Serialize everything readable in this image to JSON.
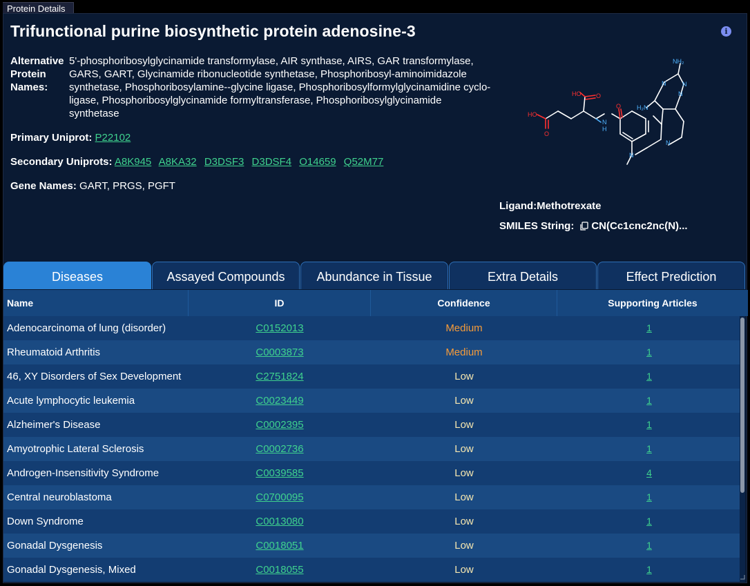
{
  "window": {
    "tab_title": "Protein Details"
  },
  "protein": {
    "title": "Trifunctional purine biosynthetic protein adenosine-3",
    "alt_names_label": "Alternative Protein Names:",
    "alt_names_value": "5'-phosphoribosylglycinamide transformylase, AIR synthase, AIRS, GAR transformylase, GARS, GART, Glycinamide ribonucleotide synthetase, Phosphoribosyl-aminoimidazole synthetase, Phosphoribosylamine--glycine ligase, Phosphoribosylformylglycinamidine cyclo-ligase, Phosphoribosylglycinamide formyltransferase, Phosphoribosylglycinamide synthetase",
    "primary_uniprot_label": "Primary Uniprot:",
    "primary_uniprot": "P22102",
    "secondary_uniprots_label": "Secondary Uniprots:",
    "secondary_uniprots": [
      "A8K945",
      "A8KA32",
      "D3DSF3",
      "D3DSF4",
      "O14659",
      "Q52M77"
    ],
    "gene_names_label": "Gene Names:",
    "gene_names": "GART, PRGS, PGFT"
  },
  "ligand": {
    "label": "Ligand:",
    "name": "Methotrexate",
    "smiles_label": "SMILES String:",
    "smiles": "CN(Cc1cnc2nc(N)...",
    "atoms": {
      "nh2_top": "NH₂",
      "h2n_left": "H₂N",
      "ho_upper": "HO",
      "ho_lower": "HO",
      "nh": "N",
      "h": "H",
      "o": "O",
      "n": "N"
    }
  },
  "tabs": [
    {
      "label": "Diseases",
      "active": true
    },
    {
      "label": "Assayed Compounds",
      "active": false
    },
    {
      "label": "Abundance in Tissue",
      "active": false
    },
    {
      "label": "Extra Details",
      "active": false
    },
    {
      "label": "Effect Prediction",
      "active": false
    }
  ],
  "table": {
    "headers": {
      "name": "Name",
      "id": "ID",
      "confidence": "Confidence",
      "articles": "Supporting Articles"
    },
    "rows": [
      {
        "name": "Adenocarcinoma of lung (disorder)",
        "id": "C0152013",
        "confidence": "Medium",
        "articles": "1"
      },
      {
        "name": "Rheumatoid Arthritis",
        "id": "C0003873",
        "confidence": "Medium",
        "articles": "1"
      },
      {
        "name": "46, XY Disorders of Sex Development",
        "id": "C2751824",
        "confidence": "Low",
        "articles": "1"
      },
      {
        "name": "Acute lymphocytic leukemia",
        "id": "C0023449",
        "confidence": "Low",
        "articles": "1"
      },
      {
        "name": "Alzheimer's Disease",
        "id": "C0002395",
        "confidence": "Low",
        "articles": "1"
      },
      {
        "name": "Amyotrophic Lateral Sclerosis",
        "id": "C0002736",
        "confidence": "Low",
        "articles": "1"
      },
      {
        "name": "Androgen-Insensitivity Syndrome",
        "id": "C0039585",
        "confidence": "Low",
        "articles": "4"
      },
      {
        "name": "Central neuroblastoma",
        "id": "C0700095",
        "confidence": "Low",
        "articles": "1"
      },
      {
        "name": "Down Syndrome",
        "id": "C0013080",
        "confidence": "Low",
        "articles": "1"
      },
      {
        "name": "Gonadal Dysgenesis",
        "id": "C0018051",
        "confidence": "Low",
        "articles": "1"
      },
      {
        "name": "Gonadal Dysgenesis, Mixed",
        "id": "C0018055",
        "confidence": "Low",
        "articles": "1"
      }
    ]
  },
  "colors": {
    "panel_bg": "#0a1a33",
    "link": "#3fd28e",
    "medium": "#f59b3a",
    "low": "#f6e7b0",
    "tab_active": "#2a82d6",
    "tab_inactive": "#0f3160"
  },
  "icons": {
    "info": "info-icon",
    "copy": "copy-icon"
  }
}
